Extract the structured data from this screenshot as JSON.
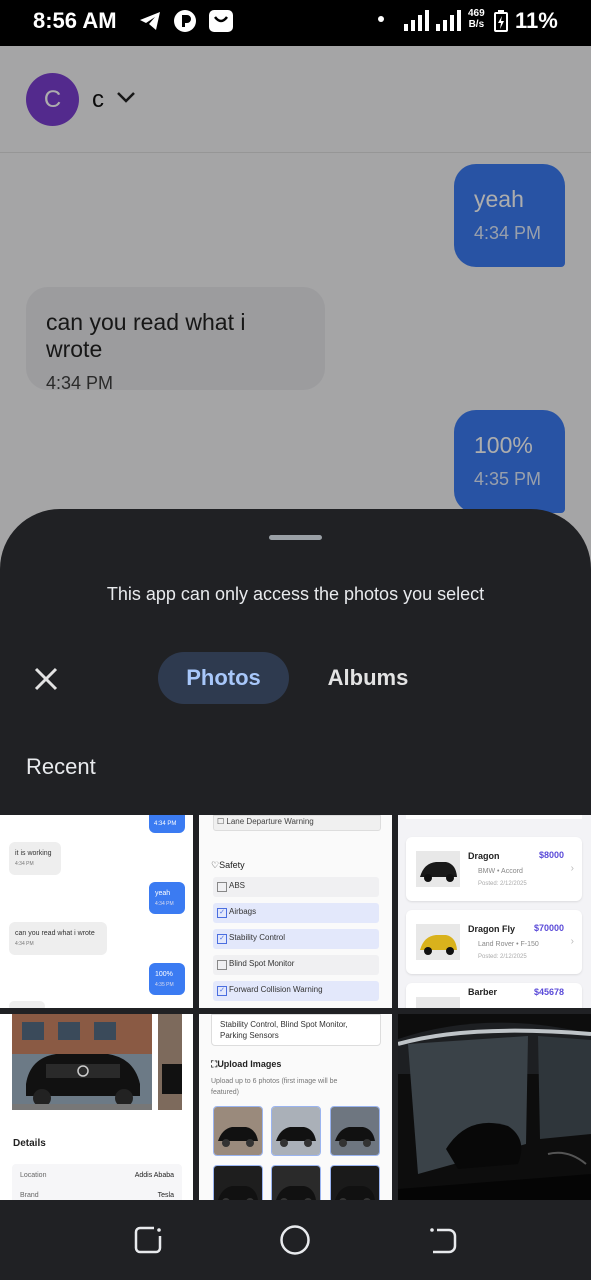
{
  "status_bar": {
    "time": "8:56 AM",
    "network_speed_value": "469",
    "network_speed_unit": "B/s",
    "battery": "11%",
    "icons": [
      "telegram-icon",
      "app-icon",
      "shop-icon",
      "dot-icon",
      "signal-icon",
      "signal-icon",
      "battery-icon"
    ]
  },
  "header": {
    "avatar_letter": "C",
    "contact_name": "c"
  },
  "messages": [
    {
      "text": "yeah",
      "time": "4:34 PM",
      "direction": "out"
    },
    {
      "text": "can you read what i wrote",
      "time": "4:34 PM",
      "direction": "in"
    },
    {
      "text": "100%",
      "time": "4:35 PM",
      "direction": "out"
    }
  ],
  "picker": {
    "notice": "This app can only access the photos you select",
    "tabs": [
      "Photos",
      "Albums"
    ],
    "active_tab": "Photos",
    "section_title": "Recent"
  },
  "thumbnails": {
    "t1": {
      "bubbles": [
        {
          "text": "4:34 PM"
        },
        {
          "text": "it is working",
          "time": "4:34 PM"
        },
        {
          "text": "yeah",
          "time": "4:34 PM"
        },
        {
          "text": "can you read what i wrote",
          "time": "4:34 PM"
        },
        {
          "text": "100%",
          "time": "4:35 PM"
        }
      ]
    },
    "t2": {
      "top_item": "Lane Departure Warning",
      "section": "Safety",
      "items": [
        {
          "label": "ABS",
          "checked": false
        },
        {
          "label": "Airbags",
          "checked": true
        },
        {
          "label": "Stability Control",
          "checked": true
        },
        {
          "label": "Blind Spot Monitor",
          "checked": false
        },
        {
          "label": "Forward Collision Warning",
          "checked": true
        }
      ]
    },
    "t3": {
      "cars": [
        {
          "name": "Dragon",
          "price": "$8000",
          "model": "BMW • Accord",
          "posted": "Posted: 2/12/2025"
        },
        {
          "name": "Dragon Fly",
          "price": "$70000",
          "model": "Land Rover • F-150",
          "posted": "Posted: 2/12/2025"
        },
        {
          "name": "Barber",
          "price": "$45678"
        }
      ]
    },
    "t4": {
      "details_title": "Details",
      "rows": [
        {
          "label": "Location",
          "value": "Addis Ababa"
        },
        {
          "label": "Brand",
          "value": "Tesla"
        }
      ]
    },
    "t5": {
      "features_text": "Stability Control, Blind Spot Monitor, Parking Sensors",
      "upload_title": "Upload Images",
      "upload_note": "Upload up to 6 photos (first image will be featured)"
    }
  },
  "colors": {
    "accent_blue": "#3b7bf2",
    "avatar_purple": "#7b3fd0",
    "sheet_bg": "#202124",
    "active_tab_bg": "#2e3a4f",
    "active_tab_text": "#a8c7fa"
  }
}
